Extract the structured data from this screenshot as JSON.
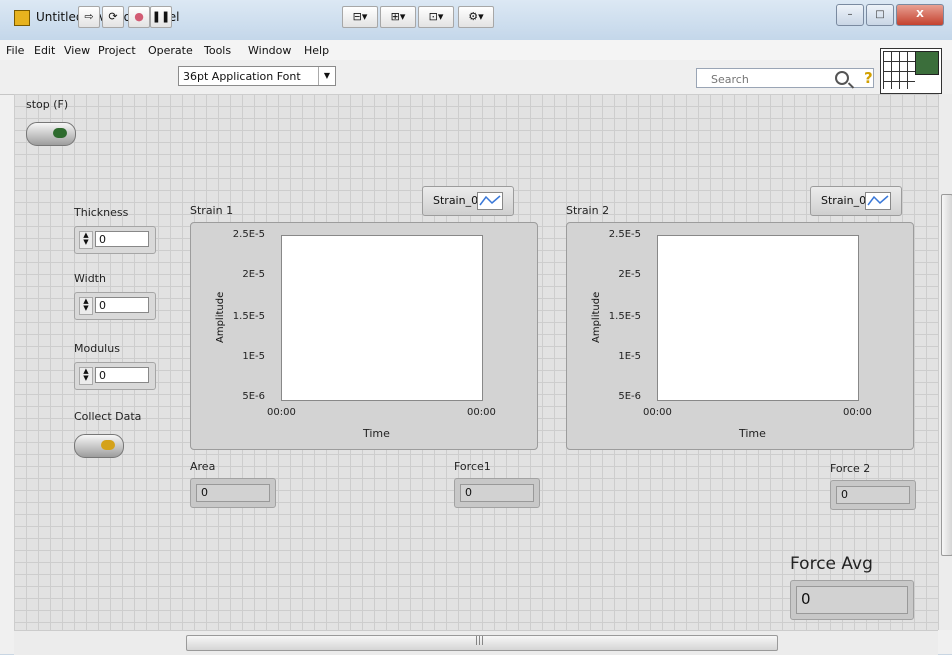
{
  "window": {
    "title": "Untitled 1.vi Front Panel",
    "min": "–",
    "max": "□",
    "close": "X"
  },
  "menu": [
    "File",
    "Edit",
    "View",
    "Project",
    "Operate",
    "Tools",
    "Window",
    "Help"
  ],
  "toolbar": {
    "font": "36pt Application Font",
    "search_placeholder": "Search"
  },
  "controls": {
    "stop_label": "stop (F)",
    "thickness_label": "Thickness",
    "thickness_value": "0",
    "width_label": "Width",
    "width_value": "0",
    "modulus_label": "Modulus",
    "modulus_value": "0",
    "collect_label": "Collect Data"
  },
  "graphs": [
    {
      "label": "Strain 1",
      "legend": "Strain_0",
      "ylabel": "Amplitude",
      "xlabel": "Time",
      "yticks": [
        "2.5E-5",
        "2E-5",
        "1.5E-5",
        "1E-5",
        "5E-6"
      ],
      "xticks": [
        "00:00",
        "00:00"
      ]
    },
    {
      "label": "Strain 2",
      "legend": "Strain_0",
      "ylabel": "Amplitude",
      "xlabel": "Time",
      "yticks": [
        "2.5E-5",
        "2E-5",
        "1.5E-5",
        "1E-5",
        "5E-6"
      ],
      "xticks": [
        "00:00",
        "00:00"
      ]
    }
  ],
  "indicators": {
    "area_label": "Area",
    "area_value": "0",
    "force1_label": "Force1",
    "force1_value": "0",
    "force2_label": "Force 2",
    "force2_value": "0",
    "forceavg_label": "Force Avg",
    "forceavg_value": "0"
  },
  "scroll": {
    "h_grip": "|||"
  }
}
